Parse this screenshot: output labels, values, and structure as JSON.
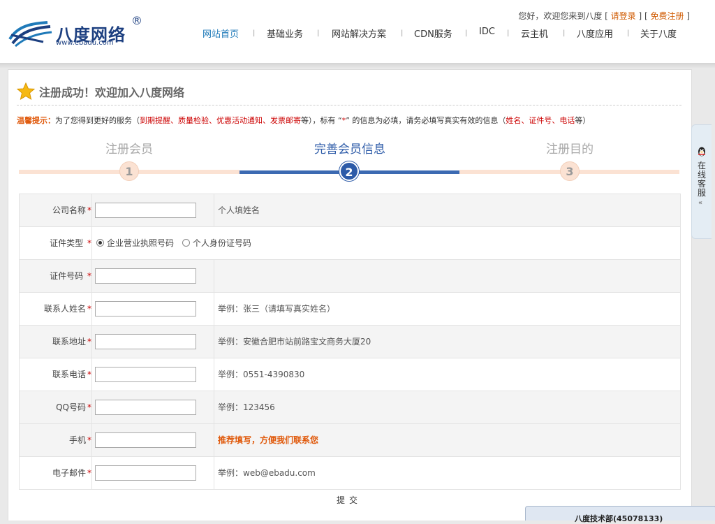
{
  "brand": {
    "name": "八度网络",
    "reg": "®",
    "url": "www.ebadu.com"
  },
  "top": {
    "greeting": "您好，欢迎您来到八度",
    "login": "请登录",
    "register": "免费注册"
  },
  "nav": {
    "items": [
      "网站首页",
      "基础业务",
      "网站解决方案",
      "CDN服务",
      "IDC",
      "云主机",
      "八度应用",
      "关于八度"
    ],
    "active": "网站首页"
  },
  "panel": {
    "title": "注册成功！欢迎加入八度网络"
  },
  "tip": {
    "label": "温馨提示：",
    "t1": "为了您得到更好的服务（",
    "r1": "到期提醒、质量检验、优惠活动通知、发票邮寄",
    "t2": "等），标有 “",
    "star": "*",
    "t3": "” 的信息为必填，请务必填写真实有效的信息（",
    "r2": "姓名、证件号、电话",
    "t4": "等）"
  },
  "steps": [
    {
      "label": "注册会员",
      "num": "1"
    },
    {
      "label": "完善会员信息",
      "num": "2"
    },
    {
      "label": "注册目的",
      "num": "3"
    }
  ],
  "form": {
    "required_mark": "*",
    "rows": [
      {
        "label": "公司名称",
        "hint": "个人填姓名"
      },
      {
        "label": "证件类型",
        "radio_1": "企业营业执照号码",
        "radio_2": "个人身份证号码"
      },
      {
        "label": "证件号码",
        "hint": ""
      },
      {
        "label": "联系人姓名",
        "hint": "举例：张三（请填写真实姓名）"
      },
      {
        "label": "联系地址",
        "hint": "举例：安徽合肥市站前路宝文商务大厦20"
      },
      {
        "label": "联系电话",
        "hint": "举例：0551-4390830"
      },
      {
        "label": "QQ号码",
        "hint": "举例：123456"
      },
      {
        "label": "手机",
        "hint": "推荐填写，方便我们联系您"
      },
      {
        "label": "电子邮件",
        "hint": "举例：web@ebadu.com"
      }
    ],
    "submit": "提交"
  },
  "side": {
    "label": "在线客服",
    "arrow": "«"
  },
  "chat": {
    "title": "八度技术部(45078133)"
  },
  "colors": {
    "accent": "#2d5ba8",
    "warn": "#e0590b",
    "red": "#cc0000"
  }
}
